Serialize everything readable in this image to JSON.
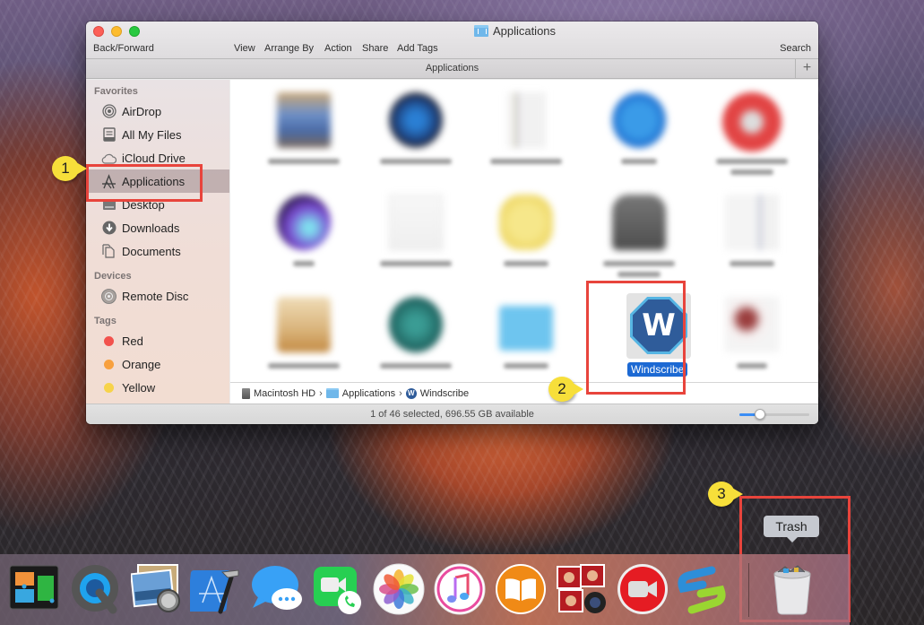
{
  "window": {
    "title": "Applications",
    "toolbar": {
      "back_forward": "Back/Forward",
      "view": "View",
      "arrange_by": "Arrange By",
      "action": "Action",
      "share": "Share",
      "add_tags": "Add Tags",
      "search": "Search"
    },
    "tab_title": "Applications",
    "tab_add": "+"
  },
  "sidebar": {
    "favorites_header": "Favorites",
    "favorites": [
      {
        "label": "AirDrop",
        "icon": "airdrop-icon"
      },
      {
        "label": "All My Files",
        "icon": "all-files-icon"
      },
      {
        "label": "iCloud Drive",
        "icon": "cloud-icon"
      },
      {
        "label": "Applications",
        "icon": "applications-icon",
        "selected": true
      },
      {
        "label": "Desktop",
        "icon": "desktop-icon"
      },
      {
        "label": "Downloads",
        "icon": "downloads-icon"
      },
      {
        "label": "Documents",
        "icon": "documents-icon"
      }
    ],
    "devices_header": "Devices",
    "devices": [
      {
        "label": "Remote Disc",
        "icon": "disc-icon"
      }
    ],
    "tags_header": "Tags",
    "tags": [
      {
        "label": "Red",
        "color": "#f2524d"
      },
      {
        "label": "Orange",
        "color": "#f8a03e"
      },
      {
        "label": "Yellow",
        "color": "#f7d34a"
      }
    ]
  },
  "content": {
    "selected_app": {
      "label": "Windscribe",
      "glyph": "W"
    },
    "blurred_labels_note": "other app labels are blurred and unreadable"
  },
  "path": {
    "items": [
      {
        "label": "Macintosh HD"
      },
      {
        "label": "Applications"
      },
      {
        "label": "Windscribe",
        "glyph": "W"
      }
    ],
    "separator": "›"
  },
  "status": {
    "text": "1 of 46 selected, 696.55 GB available",
    "icon_size_slider": 0.25
  },
  "annotations": {
    "step1": "1",
    "step2": "2",
    "step3": "3",
    "accent": "#e8443c",
    "callout_color": "#f7df3a"
  },
  "dock": {
    "items": [
      "mission-control",
      "quicktime-player",
      "preview",
      "xcode",
      "messages",
      "facetime",
      "photos",
      "itunes",
      "ibooks",
      "photo-booth",
      "zoom-video",
      "app-s"
    ],
    "trash_tooltip": "Trash"
  }
}
